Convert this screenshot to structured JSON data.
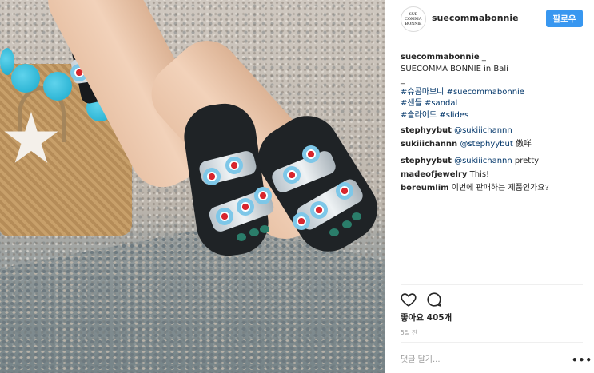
{
  "post": {
    "username": "suecommabonnie",
    "avatar_text": [
      "SUE",
      "COMMA",
      "BONNIE"
    ],
    "follow_label": "팔로우"
  },
  "caption": {
    "username": "suecommabonnie",
    "suffix": " _",
    "line1": "SUECOMMA BONNIE in Bali",
    "line2": "_",
    "tags": [
      [
        "#슈콤마보니",
        "#suecommabonnie"
      ],
      [
        "#샌들",
        "#sandal"
      ],
      [
        "#슬라이드",
        "#slides"
      ]
    ]
  },
  "comments": [
    {
      "user": "stephyybut",
      "mention": "@sukiiichannn",
      "text": ""
    },
    {
      "user": "sukiiichannn",
      "mention": "@stephyybut",
      "text": " 傲咩"
    },
    {
      "user": "stephyybut",
      "mention": "@sukiiichannn",
      "text": " pretty"
    },
    {
      "user": "madeofjewelry",
      "mention": "",
      "text": "This!"
    },
    {
      "user": "boreumlim",
      "mention": "",
      "text": "이번에 판매하는 제품인가요?"
    }
  ],
  "actions": {
    "like_icon": "heart-icon",
    "comment_icon": "comment-icon"
  },
  "likes": "좋아요 405개",
  "timestamp": "5일 전",
  "comment_input": {
    "placeholder": "댓글 달기..."
  },
  "more_label": "•••",
  "colors": {
    "accent": "#3897f0",
    "hashtag": "#003569",
    "text": "#262626",
    "muted": "#999999"
  }
}
